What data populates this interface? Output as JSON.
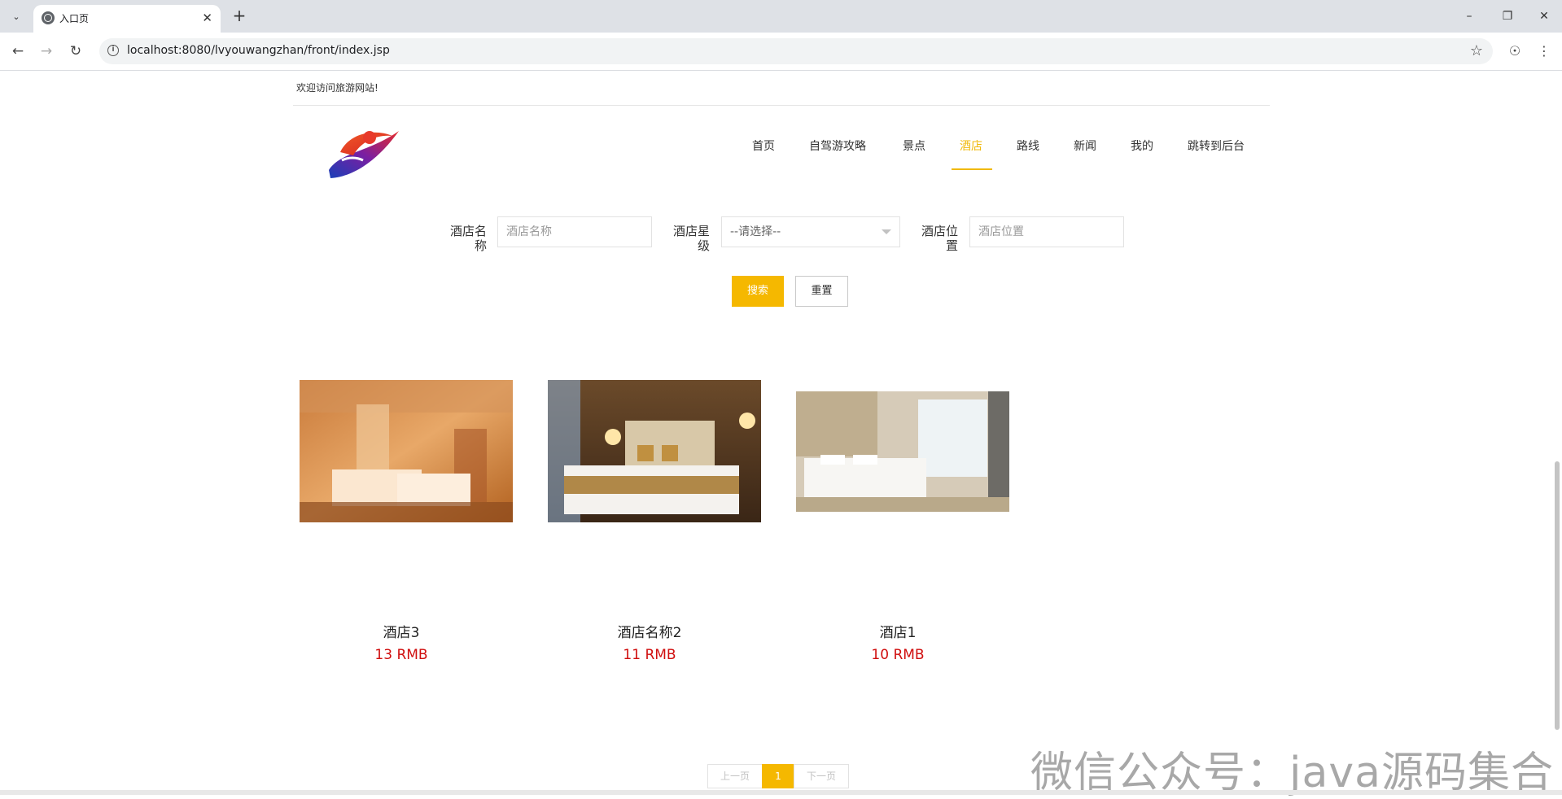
{
  "browser": {
    "tab_title": "入口页",
    "url": "localhost:8080/lvyouwangzhan/front/index.jsp"
  },
  "header": {
    "welcome": "欢迎访问旅游网站!"
  },
  "nav": {
    "items": [
      {
        "label": "首页",
        "active": false
      },
      {
        "label": "自驾游攻略",
        "active": false
      },
      {
        "label": "景点",
        "active": false
      },
      {
        "label": "酒店",
        "active": true
      },
      {
        "label": "路线",
        "active": false
      },
      {
        "label": "新闻",
        "active": false
      },
      {
        "label": "我的",
        "active": false
      },
      {
        "label": "跳转到后台",
        "active": false
      }
    ]
  },
  "search": {
    "name_label_line1": "酒店名",
    "name_label_line2": "称",
    "name_placeholder": "酒店名称",
    "star_label_line1": "酒店星",
    "star_label_line2": "级",
    "star_selected": "--请选择--",
    "location_label_line1": "酒店位",
    "location_label_line2": "置",
    "location_placeholder": "酒店位置",
    "search_button": "搜索",
    "reset_button": "重置"
  },
  "hotels": [
    {
      "name": "酒店3",
      "price": "13 RMB"
    },
    {
      "name": "酒店名称2",
      "price": "11 RMB"
    },
    {
      "name": "酒店1",
      "price": "10 RMB"
    }
  ],
  "pagination": {
    "prev": "上一页",
    "current": "1",
    "next": "下一页"
  },
  "watermark": "微信公众号：java源码集合",
  "colors": {
    "accent": "#f5b800",
    "price": "#d00f0f"
  }
}
